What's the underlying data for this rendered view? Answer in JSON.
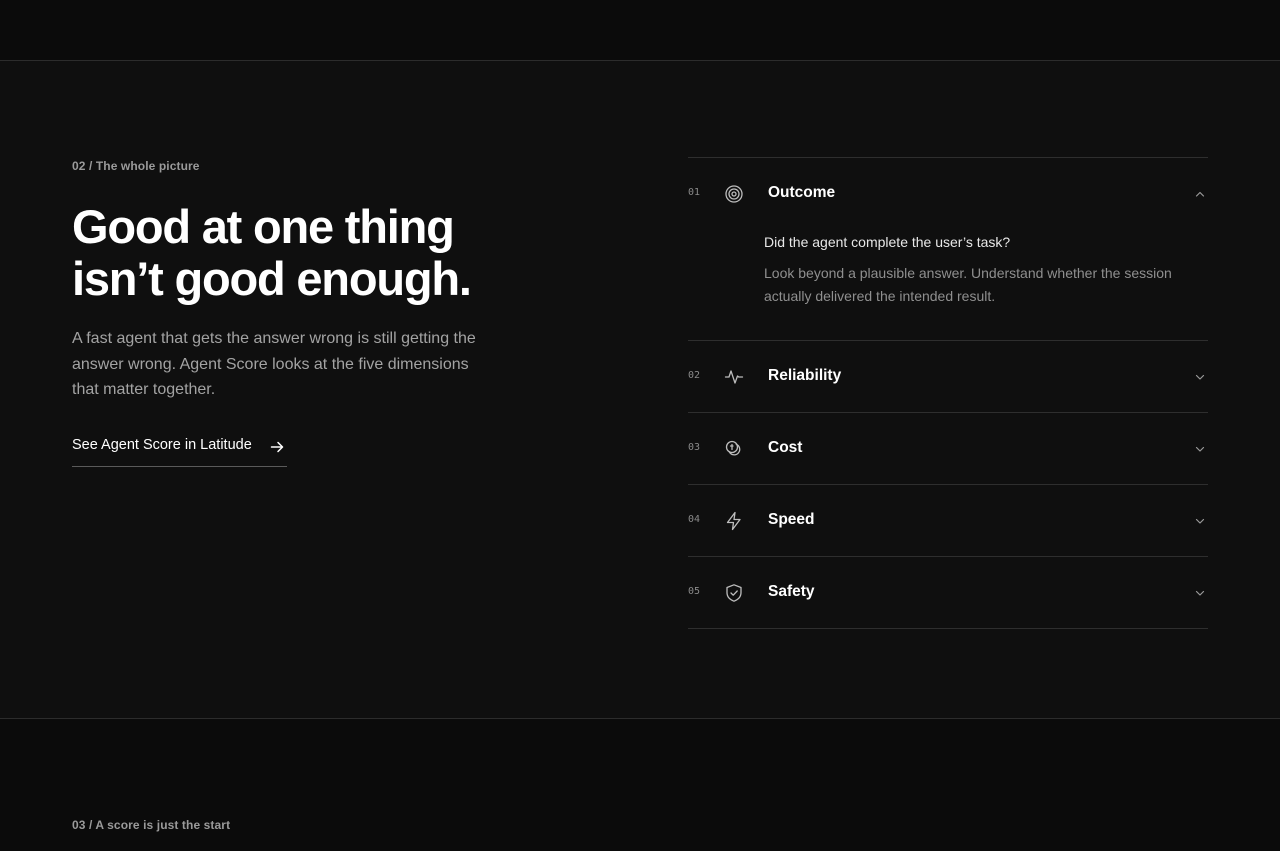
{
  "section": {
    "eyebrow": "02 / The whole picture",
    "headline_line1": "Good at one thing",
    "headline_line2": "isn’t good enough.",
    "lede": "A fast agent that gets the answer wrong is still getting the answer wrong. Agent Score looks at the five dimensions that matter together.",
    "cta_label": "See Agent Score in Latitude",
    "cta_icon": "arrow-right-icon"
  },
  "accordion": {
    "items": [
      {
        "number": "01",
        "title": "Outcome",
        "icon": "target-icon",
        "expanded": true,
        "question": "Did the agent complete the user’s task?",
        "answer": "Look beyond a plausible answer. Understand whether the session actually delivered the intended result."
      },
      {
        "number": "02",
        "title": "Reliability",
        "icon": "pulse-icon",
        "expanded": false
      },
      {
        "number": "03",
        "title": "Cost",
        "icon": "coins-icon",
        "expanded": false
      },
      {
        "number": "04",
        "title": "Speed",
        "icon": "lightning-icon",
        "expanded": false
      },
      {
        "number": "05",
        "title": "Safety",
        "icon": "shield-check-icon",
        "expanded": false
      }
    ]
  },
  "next_section": {
    "eyebrow": "03 / A score is just the start"
  }
}
